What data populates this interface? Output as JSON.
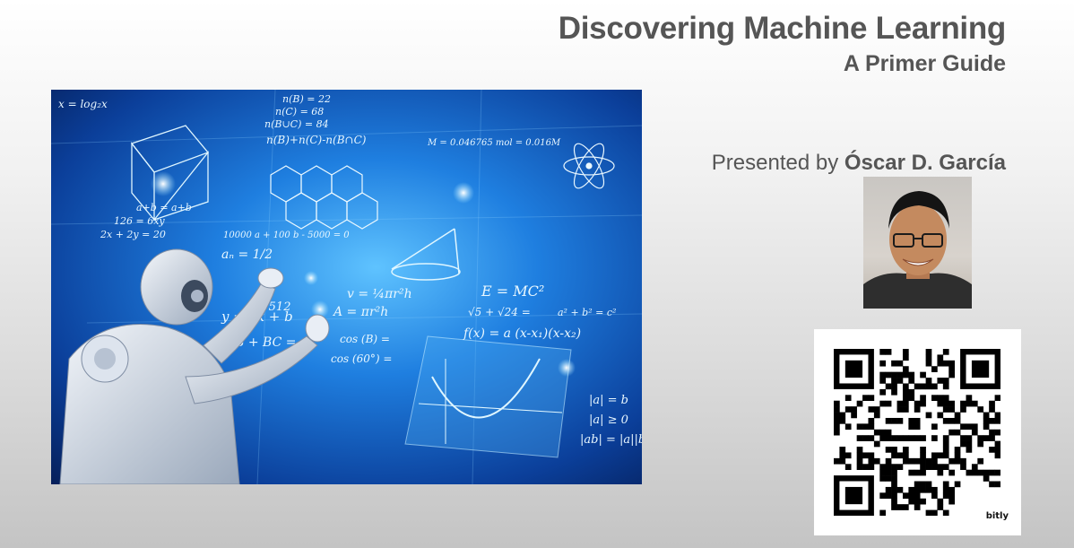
{
  "slide": {
    "title": "Discovering Machine Learning",
    "subtitle": "A Primer Guide",
    "presenter_prefix": "Presented by",
    "presenter_name": "Óscar D. García",
    "qr_brand": "bitly"
  },
  "hero": {
    "formulas": [
      "n(B) = 22",
      "n(C) = 68",
      "n(B∪C) = 84",
      "n(B)+n(C)-n(B∩C)",
      "E = MC²",
      "v = ¼πr²h",
      "A = πr²h",
      "y = ax + b",
      "AB + BC =",
      "cos (B) =",
      "cos (60°) =",
      "f(x) = a (x-x₁)(x-x₂)",
      "√5 + √24 =",
      "x = log₂x",
      "a+b = a+b",
      "126 = 6xy",
      "2x + 2y = 20",
      "aₙ = 1/2",
      "1/512",
      "a² + b² = c²",
      "10000 a + 100 b - 5000 = 0",
      "M = 0.046765 mol = 0.016M",
      "|a| = b",
      "|a| ≥ 0",
      "|ab| = |a||b|"
    ],
    "colors": {
      "glow": "#9fe3ff",
      "panel": "#1f7fe0"
    }
  }
}
